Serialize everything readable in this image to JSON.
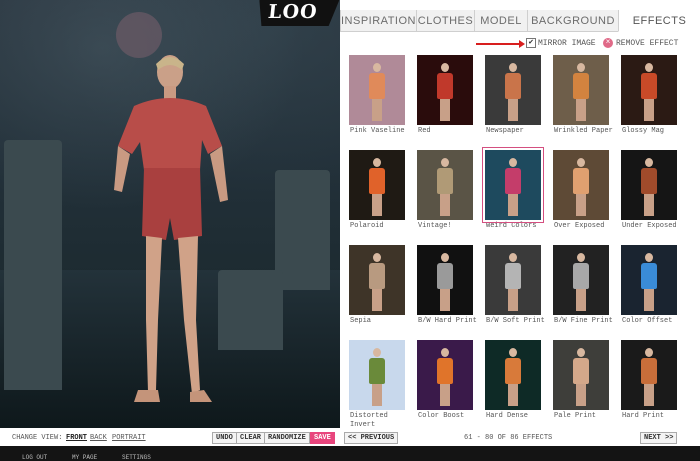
{
  "logo": {
    "text": "LOO"
  },
  "tabs": [
    {
      "label": "INSPIRATION",
      "active": false
    },
    {
      "label": "CLOTHES",
      "active": false
    },
    {
      "label": "MODEL",
      "active": false
    },
    {
      "label": "BACKGROUND",
      "active": false
    },
    {
      "label": "EFFECTS",
      "active": true
    }
  ],
  "mirror": {
    "label": "MIRROR IMAGE",
    "checked": true
  },
  "remove_effect": {
    "label": "REMOVE EFFECT"
  },
  "effects": [
    {
      "name": "Pink Vaseline",
      "bg": "#b08a98",
      "fig": "#e08a5a"
    },
    {
      "name": "Red",
      "bg": "#2a0c0c",
      "fig": "#c0392b"
    },
    {
      "name": "Newspaper",
      "bg": "#3a3a3a",
      "fig": "#c9744a"
    },
    {
      "name": "Wrinkled Paper",
      "bg": "#6e5e4a",
      "fig": "#d3833f"
    },
    {
      "name": "Glossy Mag",
      "bg": "#2b1a14",
      "fig": "#c84a28"
    },
    {
      "name": "Polaroid",
      "bg": "#1f1a14",
      "fig": "#e0622a"
    },
    {
      "name": "Vintage!",
      "bg": "#5a5446",
      "fig": "#b09a76"
    },
    {
      "name": "Weird Colors",
      "bg": "#1e4a5e",
      "fig": "#c43d6a"
    },
    {
      "name": "Over Exposed",
      "bg": "#5e4a36",
      "fig": "#e0a070"
    },
    {
      "name": "Under Exposed",
      "bg": "#151515",
      "fig": "#a04b2b"
    },
    {
      "name": "Sepia",
      "bg": "#3e3428",
      "fig": "#b89a80"
    },
    {
      "name": "B/W Hard Print",
      "bg": "#111111",
      "fig": "#9a9a9a"
    },
    {
      "name": "B/W Soft Print",
      "bg": "#3a3a3a",
      "fig": "#b4b4b4"
    },
    {
      "name": "B/W Fine Print",
      "bg": "#222222",
      "fig": "#a8a8a8"
    },
    {
      "name": "Color Offset",
      "bg": "#1a2430",
      "fig": "#3a8cd8"
    },
    {
      "name": "Distorted Invert",
      "bg": "#c8d8ec",
      "fig": "#6a8a3a"
    },
    {
      "name": "Color Boost",
      "bg": "#3a1a4a",
      "fig": "#e0742a"
    },
    {
      "name": "Hard Dense",
      "bg": "#0e2a26",
      "fig": "#d87a3a"
    },
    {
      "name": "Pale Print",
      "bg": "#3e3e3a",
      "fig": "#d4a88a"
    },
    {
      "name": "Hard Print",
      "bg": "#1a1a1a",
      "fig": "#c86e3a"
    }
  ],
  "selected_effect": "Weird Colors",
  "bottom": {
    "change_view": "CHANGE VIEW:",
    "views": [
      "FRONT",
      "BACK",
      "PORTRAIT"
    ],
    "undo": "UNDO",
    "clear": "CLEAR",
    "randomize": "RANDOMIZE",
    "save": "SAVE",
    "prev": "<< PREVIOUS",
    "count": "61 - 80 OF 86 EFFECTS",
    "next": "NEXT >>"
  },
  "footer": {
    "items": [
      "LOG OUT",
      "MY PAGE",
      "SETTINGS"
    ]
  },
  "colors": {
    "accent": "#e8457d",
    "arrow": "#d81e1e"
  }
}
